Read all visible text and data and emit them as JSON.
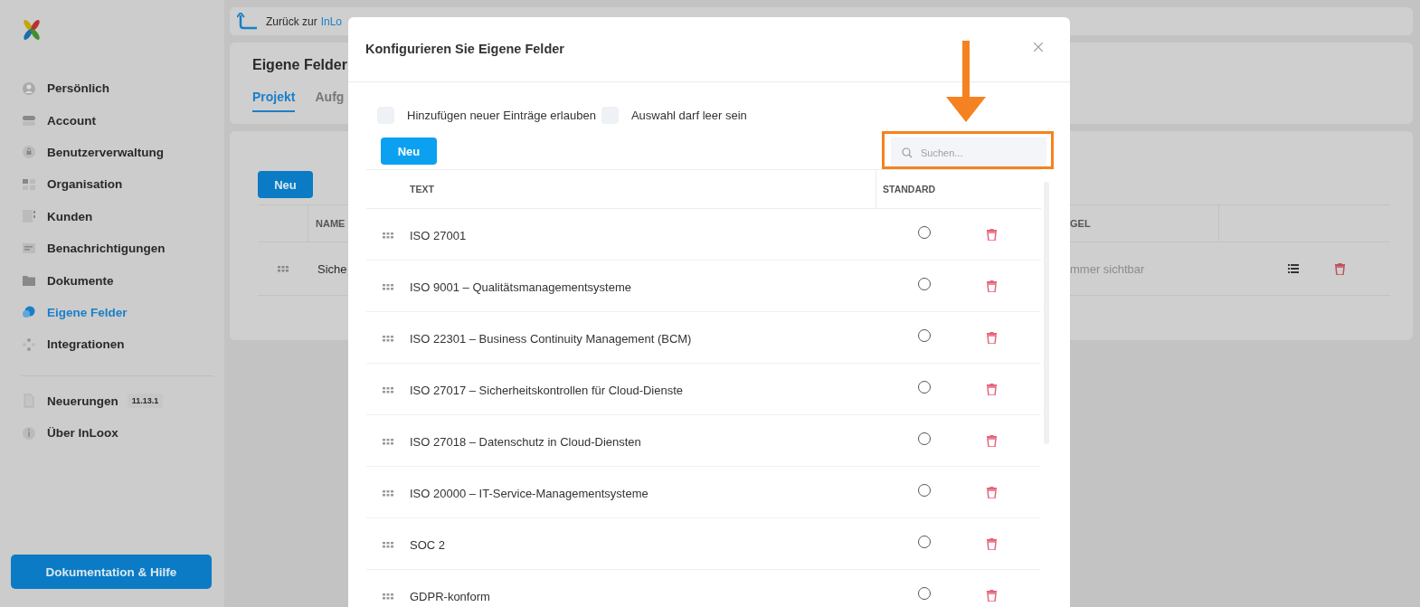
{
  "back_bar": {
    "prefix": "Zurück zur",
    "link": "InLo"
  },
  "sidebar": {
    "items": [
      {
        "label": "Persönlich",
        "kind": "person",
        "selected": false
      },
      {
        "label": "Account",
        "kind": "toggle",
        "selected": false
      },
      {
        "label": "Benutzerverwaltung",
        "kind": "lock",
        "selected": false
      },
      {
        "label": "Organisation",
        "kind": "grid",
        "selected": false
      },
      {
        "label": "Kunden",
        "kind": "list",
        "selected": false
      },
      {
        "label": "Benachrichtigungen",
        "kind": "message",
        "selected": false
      },
      {
        "label": "Dokumente",
        "kind": "folder",
        "selected": false
      },
      {
        "label": "Eigene Felder",
        "kind": "blob",
        "selected": true
      },
      {
        "label": "Integrationen",
        "kind": "dots",
        "selected": false
      }
    ],
    "news": {
      "label": "Neuerungen",
      "badge": "11.13.1"
    },
    "about": "Über InLoox",
    "help_button": "Dokumentation & Hilfe"
  },
  "page": {
    "title": "Eigene Felder",
    "tabs": [
      {
        "label": "Projekt",
        "selected": true
      },
      {
        "label": "Aufg",
        "selected": false
      }
    ],
    "new_button": "Neu",
    "table": {
      "columns": [
        "NAME",
        "GEL"
      ],
      "rows": [
        {
          "name": "Siche",
          "column_2": "mmer sichtbar"
        }
      ]
    }
  },
  "dialog": {
    "title": "Konfigurieren Sie Eigene Felder",
    "options": [
      {
        "label": "Hinzufügen neuer Einträge erlauben",
        "checked": false
      },
      {
        "label": "Auswahl darf leer sein",
        "checked": false
      }
    ],
    "new_button": "Neu",
    "search": {
      "placeholder": "Suchen..."
    },
    "columns": [
      "TEXT",
      "STANDARD"
    ],
    "rows": [
      {
        "text": "ISO 27001",
        "selected": false
      },
      {
        "text": "ISO 9001 – Qualitätsmanagementsysteme",
        "selected": false
      },
      {
        "text": "ISO 22301 – Business Continuity Management (BCM)",
        "selected": false
      },
      {
        "text": "ISO 27017 – Sicherheitskontrollen für Cloud-Dienste",
        "selected": false
      },
      {
        "text": "ISO 27018 – Datenschutz in Cloud-Diensten",
        "selected": false
      },
      {
        "text": "ISO 20000 – IT-Service-Managementsysteme",
        "selected": false
      },
      {
        "text": "SOC 2",
        "selected": false
      },
      {
        "text": "GDPR-konform",
        "selected": false
      }
    ]
  }
}
